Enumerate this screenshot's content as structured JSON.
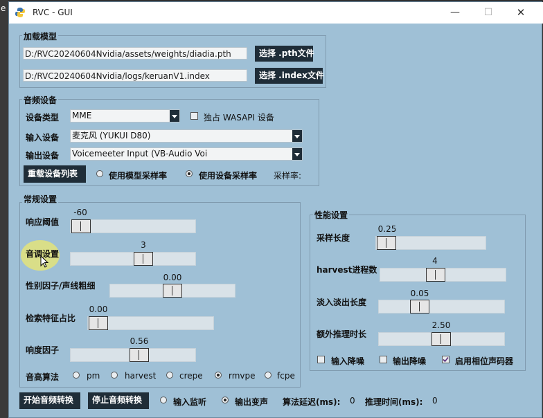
{
  "app": {
    "title": "RVC - GUI"
  },
  "window_controls": {
    "minimize": "—",
    "maximize": "☐",
    "close": "✕"
  },
  "model": {
    "legend": "加载模型",
    "pth_path": "D:/RVC20240604Nvidia/assets/weights/diadia.pth",
    "pth_button": "选择 .pth文件",
    "index_path": "D:/RVC20240604Nvidia/logs/keruanV1.index",
    "index_button": "选择 .index文件"
  },
  "audio": {
    "legend": "音频设备",
    "device_type_label": "设备类型",
    "device_type_value": "MME",
    "wasapi_label": "独占 WASAPI 设备",
    "input_label": "输入设备",
    "input_value": "麦克风 (YUKUI D80)",
    "output_label": "输出设备",
    "output_value": "Voicemeeter Input (VB-Audio Voi",
    "reload_button": "重载设备列表",
    "rate_model": "使用模型采样率",
    "rate_device": "使用设备采样率",
    "rate_label": "采样率:"
  },
  "general": {
    "legend": "常规设置",
    "threshold": {
      "label": "响应阈值",
      "value": "-60"
    },
    "pitch": {
      "label": "音调设置",
      "value": "3"
    },
    "formant": {
      "label": "性别因子/声线粗细",
      "value": "0.00"
    },
    "index_rate": {
      "label": "检索特征占比",
      "value": "0.00"
    },
    "rms": {
      "label": "响度因子",
      "value": "0.56"
    },
    "f0_label": "音高算法",
    "f0_methods": [
      "pm",
      "harvest",
      "crepe",
      "rmvpe",
      "fcpe"
    ],
    "f0_selected": "rmvpe"
  },
  "perf": {
    "legend": "性能设置",
    "block": {
      "label": "采样长度",
      "value": "0.25"
    },
    "n_cpu": {
      "label": "harvest进程数",
      "value": "4"
    },
    "crossfade": {
      "label": "淡入淡出长度",
      "value": "0.05"
    },
    "extra": {
      "label": "额外推理时长",
      "value": "2.50"
    },
    "in_denoise": "输入降噪",
    "out_denoise": "输出降噪",
    "phase_vocoder": "启用相位声码器"
  },
  "bottom": {
    "start_button": "开始音频转换",
    "stop_button": "停止音频转换",
    "monitor_label": "输入监听",
    "output_label": "输出变声",
    "delay_label": "算法延迟(ms):",
    "delay_value": "0",
    "infer_label": "推理时间(ms):",
    "infer_value": "0"
  },
  "colors": {
    "window_bg": "#9fc0d6",
    "button_bg": "#1f2d38",
    "highlight": "#ece86e"
  }
}
